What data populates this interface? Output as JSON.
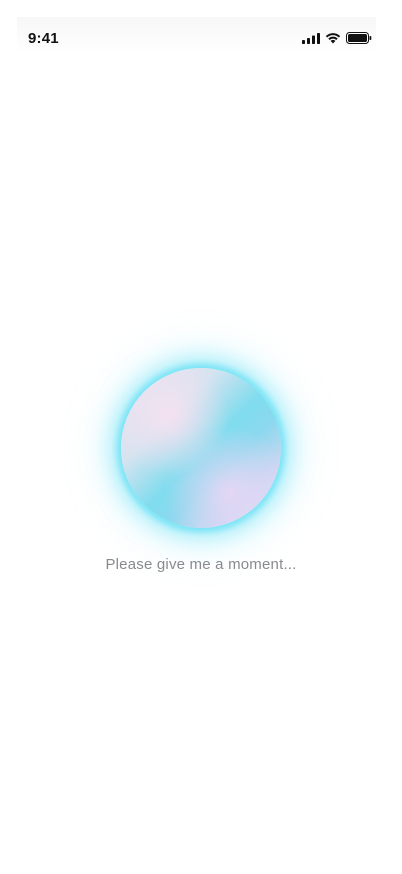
{
  "status_bar": {
    "time": "9:41",
    "icons": [
      "signal-icon",
      "wifi-icon",
      "battery-icon"
    ]
  },
  "orb": {
    "glow_color": "#6fe0f5",
    "accent_color": "#7fdcee"
  },
  "loading": {
    "message": "Please give me a moment..."
  }
}
